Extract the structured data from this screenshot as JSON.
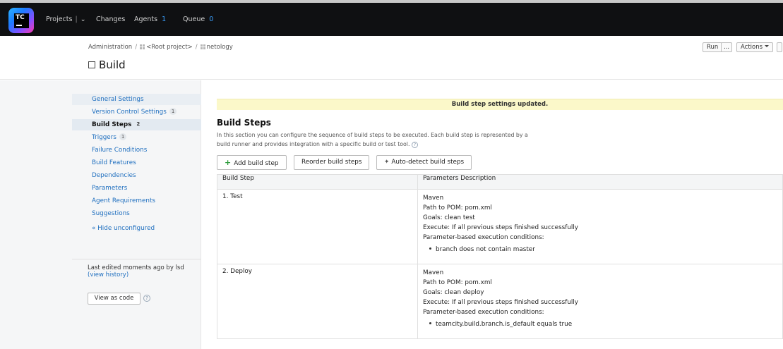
{
  "topnav": {
    "logo_text": "TC",
    "projects": "Projects",
    "changes": "Changes",
    "agents": "Agents",
    "agents_count": "1",
    "queue": "Queue",
    "queue_count": "0"
  },
  "header": {
    "breadcrumb": [
      "Administration",
      "<Root project>",
      "netology"
    ],
    "title": "Build",
    "run_label": "Run",
    "more_label": "...",
    "actions_label": "Actions"
  },
  "sidebar": {
    "items": [
      {
        "label": "General Settings",
        "badge": ""
      },
      {
        "label": "Version Control Settings",
        "badge": "1"
      },
      {
        "label": "Build Steps",
        "badge": "2"
      },
      {
        "label": "Triggers",
        "badge": "1"
      },
      {
        "label": "Failure Conditions",
        "badge": ""
      },
      {
        "label": "Build Features",
        "badge": ""
      },
      {
        "label": "Dependencies",
        "badge": ""
      },
      {
        "label": "Parameters",
        "badge": ""
      },
      {
        "label": "Agent Requirements",
        "badge": ""
      },
      {
        "label": "Suggestions",
        "badge": ""
      }
    ],
    "hide_unconfigured": "« Hide unconfigured",
    "last_edited_prefix": "Last edited",
    "last_edited_when": "moments ago",
    "last_edited_by": "by lsd",
    "view_history": "(view history)",
    "view_as_code": "View as code"
  },
  "main": {
    "notice": "Build step settings updated.",
    "section_title": "Build Steps",
    "section_desc": "In this section you can configure the sequence of build steps to be executed. Each build step is represented by a build runner and provides integration with a specific build or test tool.",
    "add_step": "Add build step",
    "reorder_steps": "Reorder build steps",
    "autodetect_steps": "Auto-detect build steps",
    "table": {
      "headers": [
        "Build Step",
        "Parameters Description"
      ],
      "rows": [
        {
          "step": "1. Test",
          "runner": "Maven",
          "pom": "Path to POM: pom.xml",
          "goals": "Goals: clean test",
          "execute": "Execute: If all previous steps finished successfully",
          "cond_label": "Parameter-based execution conditions:",
          "condition": "branch does not contain master"
        },
        {
          "step": "2. Deploy",
          "runner": "Maven",
          "pom": "Path to POM: pom.xml",
          "goals": "Goals: clean deploy",
          "execute": "Execute: If all previous steps finished successfully",
          "cond_label": "Parameter-based execution conditions:",
          "condition": "teamcity.build.branch.is_default equals true"
        }
      ]
    }
  },
  "colors": {
    "topbar": "#0f1012",
    "link": "#1f6fbf",
    "notice_bg": "#fbf8c9",
    "count_blue": "#3aa0ff"
  }
}
